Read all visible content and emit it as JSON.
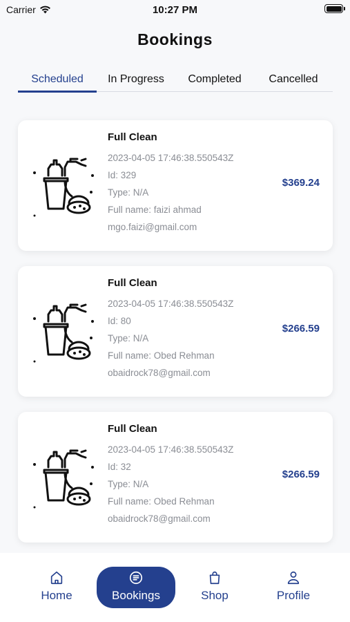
{
  "status_bar": {
    "carrier": "Carrier",
    "time": "10:27 PM"
  },
  "page_title": "Bookings",
  "tabs": [
    {
      "label": "Scheduled",
      "active": true
    },
    {
      "label": "In Progress",
      "active": false
    },
    {
      "label": "Completed",
      "active": false
    },
    {
      "label": "Cancelled",
      "active": false
    }
  ],
  "bookings": [
    {
      "icon": "cleaning-supplies-icon",
      "title": "Full Clean",
      "datetime": "2023-04-05 17:46:38.550543Z",
      "id": "Id: 329",
      "type": "Type: N/A",
      "full_name": "Full name: faizi ahmad",
      "email": "mgo.faizi@gmail.com",
      "price": "$369.24"
    },
    {
      "icon": "cleaning-supplies-icon",
      "title": "Full Clean",
      "datetime": "2023-04-05 17:46:38.550543Z",
      "id": "Id: 80",
      "type": "Type: N/A",
      "full_name": "Full name: Obed Rehman",
      "email": "obaidrock78@gmail.com",
      "price": "$266.59"
    },
    {
      "icon": "cleaning-supplies-icon",
      "title": "Full Clean",
      "datetime": "2023-04-05 17:46:38.550543Z",
      "id": "Id: 32",
      "type": "Type: N/A",
      "full_name": "Full name: Obed Rehman",
      "email": "obaidrock78@gmail.com",
      "price": "$266.59"
    }
  ],
  "bottom_nav": [
    {
      "label": "Home",
      "icon": "home-icon",
      "active": false
    },
    {
      "label": "Bookings",
      "icon": "bookings-icon",
      "active": true
    },
    {
      "label": "Shop",
      "icon": "shopping-bag-icon",
      "active": false
    },
    {
      "label": "Profile",
      "icon": "profile-icon",
      "active": false
    }
  ],
  "colors": {
    "accent": "#24408e",
    "muted_text": "#8a8d94",
    "background": "#f7f8fa"
  }
}
